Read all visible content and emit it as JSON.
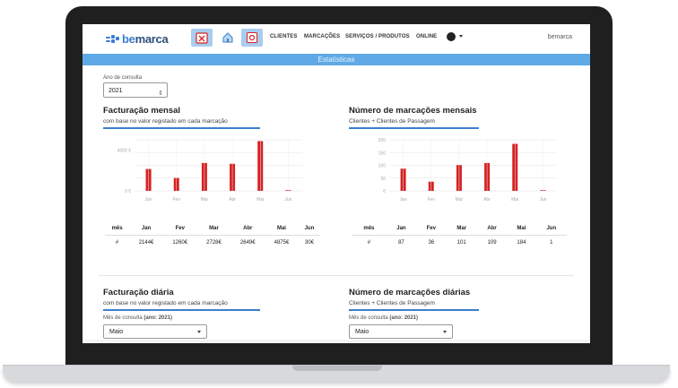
{
  "brand": {
    "name_prefix": "be",
    "name_suffix": "marca"
  },
  "nav": {
    "links": [
      "CLIENTES",
      "MARCAÇÕES",
      "SERVIÇOS / PRODUTOS",
      "ONLINE"
    ],
    "user": "bemarca"
  },
  "banner": "Estatísticas",
  "year": {
    "label": "Ano de consulta",
    "value": "2021"
  },
  "sections": {
    "fact_mensal": {
      "title": "Facturação mensal",
      "subtitle": "com base no valor registado em cada marcação"
    },
    "marc_mensal": {
      "title": "Número de marcações mensais",
      "subtitle": "Clientes + Clientes de Passagem"
    },
    "fact_diaria": {
      "title": "Facturação diária",
      "subtitle": "com base no valor registado em cada marcação",
      "select_label": "Mês de consulta",
      "select_label_bold": "(ano: 2021)",
      "select_value": "Maio"
    },
    "marc_diaria": {
      "title": "Número de marcações diárias",
      "subtitle": "Clientes + Clientes de Passagem",
      "select_label": "Mês de consulta",
      "select_label_bold": "(ano: 2021)",
      "select_value": "Maio"
    }
  },
  "tables": {
    "fact_mensal": {
      "header_label": "mês",
      "row_label": "#",
      "months": [
        "Jan",
        "Fev",
        "Mar",
        "Abr",
        "Mai",
        "Jun"
      ],
      "values": [
        "2144€",
        "1260€",
        "2728€",
        "2649€",
        "4875€",
        "30€"
      ]
    },
    "marc_mensal": {
      "header_label": "mês",
      "row_label": "#",
      "months": [
        "Jan",
        "Fev",
        "Mar",
        "Abr",
        "Mai",
        "Jun"
      ],
      "values": [
        "87",
        "36",
        "101",
        "109",
        "184",
        "1"
      ]
    }
  },
  "chart_data": [
    {
      "type": "bar",
      "title": "Facturação mensal",
      "categories": [
        "Jan",
        "Fev",
        "Mar",
        "Abr",
        "Mai",
        "Jun"
      ],
      "values": [
        2144,
        1260,
        2728,
        2649,
        4875,
        30
      ],
      "ytick_labels": [
        "0 €",
        "4000 €"
      ],
      "ylim": [
        0,
        5000
      ],
      "grid": true,
      "color": "#d62222"
    },
    {
      "type": "bar",
      "title": "Número de marcações mensais",
      "categories": [
        "Jan",
        "Fev",
        "Mar",
        "Abr",
        "Mai",
        "Jun"
      ],
      "values": [
        87,
        36,
        101,
        109,
        184,
        1
      ],
      "ytick_labels": [
        "0",
        "50",
        "100",
        "150",
        "200"
      ],
      "yticks": [
        0,
        50,
        100,
        150,
        200
      ],
      "ylim": [
        0,
        200
      ],
      "grid": true,
      "color": "#d62222"
    }
  ],
  "icons": {
    "play": "play-icon",
    "home": "home-icon",
    "gear": "gear-icon"
  },
  "colors": {
    "accent": "#3b7fd1",
    "banner": "#5fa9e6",
    "bar": "#d62222"
  }
}
